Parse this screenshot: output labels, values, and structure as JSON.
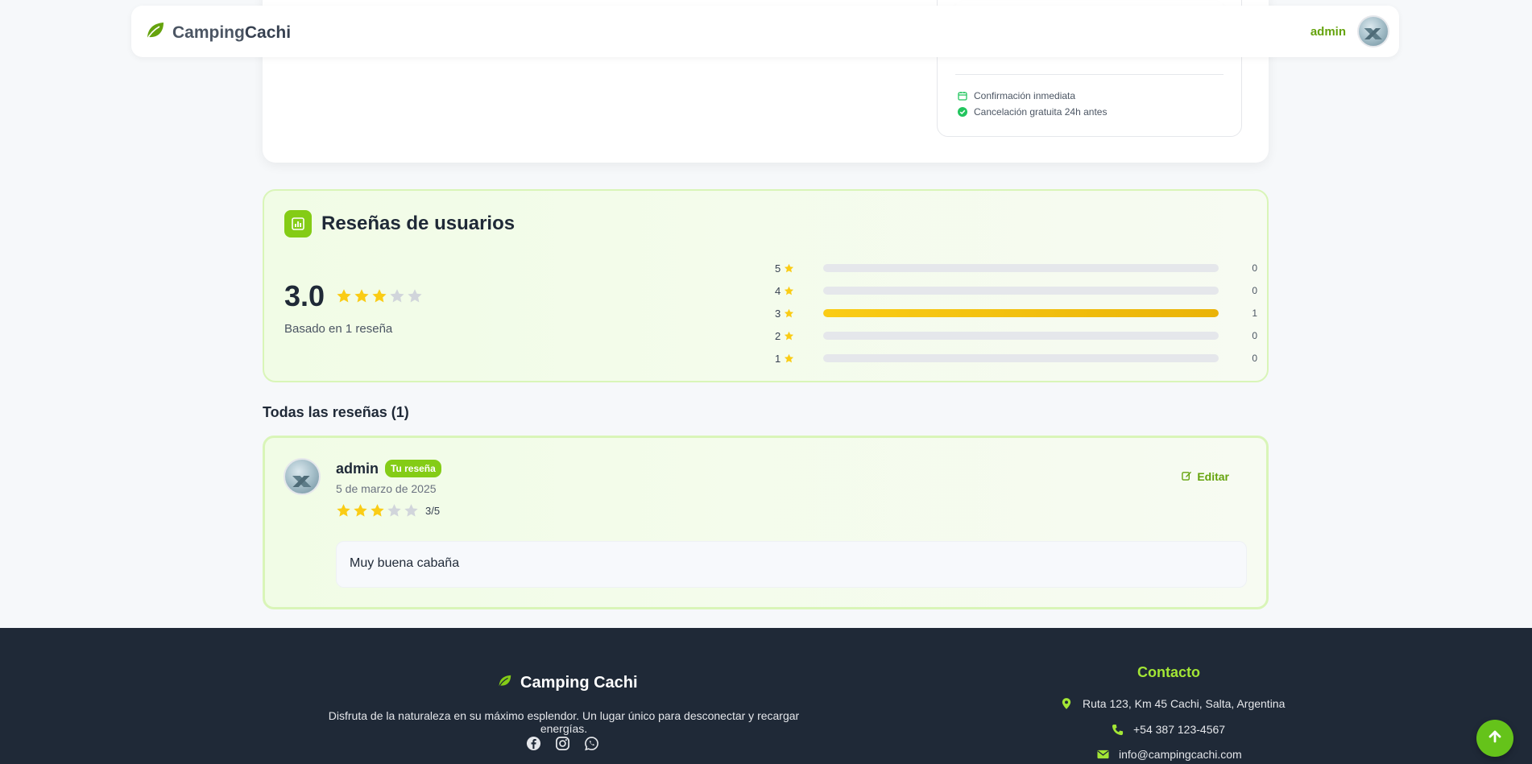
{
  "nav": {
    "brand_first": "Camping",
    "brand_second": "Cachi",
    "user_name": "admin"
  },
  "booking": {
    "features": [
      {
        "icon": "calendar-icon",
        "label": "Confirmación inmediata"
      },
      {
        "icon": "check-circle-icon",
        "label": "Cancelación gratuita 24h antes"
      }
    ]
  },
  "reviews_summary": {
    "title": "Reseñas de usuarios",
    "average": "3.0",
    "average_stars": 3,
    "based_on": "Basado en 1 reseña",
    "distribution": [
      {
        "stars": "5",
        "count": "0",
        "fraction": 0
      },
      {
        "stars": "4",
        "count": "0",
        "fraction": 0
      },
      {
        "stars": "3",
        "count": "1",
        "fraction": 1
      },
      {
        "stars": "2",
        "count": "0",
        "fraction": 0
      },
      {
        "stars": "1",
        "count": "0",
        "fraction": 0
      }
    ]
  },
  "all_reviews": {
    "title": "Todas las reseñas (1)",
    "items": [
      {
        "author": "admin",
        "badge": "Tu reseña",
        "date": "5 de marzo de 2025",
        "stars": 3,
        "score": "3/5",
        "edit_label": "Editar",
        "comment": "Muy buena cabaña"
      }
    ]
  },
  "footer": {
    "brand": "Camping Cachi",
    "tagline": "Disfruta de la naturaleza en su máximo esplendor. Un lugar único para desconectar y recargar energías.",
    "socials": [
      "facebook-icon",
      "instagram-icon",
      "whatsapp-icon"
    ],
    "contact_title": "Contacto",
    "address": "Ruta 123, Km 45 Cachi, Salta, Argentina",
    "phone": "+54 387 123-4567",
    "email": "info@campingcachi.com"
  },
  "colors": {
    "accent": "#84cc16",
    "accent_dark": "#65a30d",
    "star_filled": "#facc15",
    "star_empty": "#d1d5db",
    "footer_bg": "#1f2937"
  }
}
